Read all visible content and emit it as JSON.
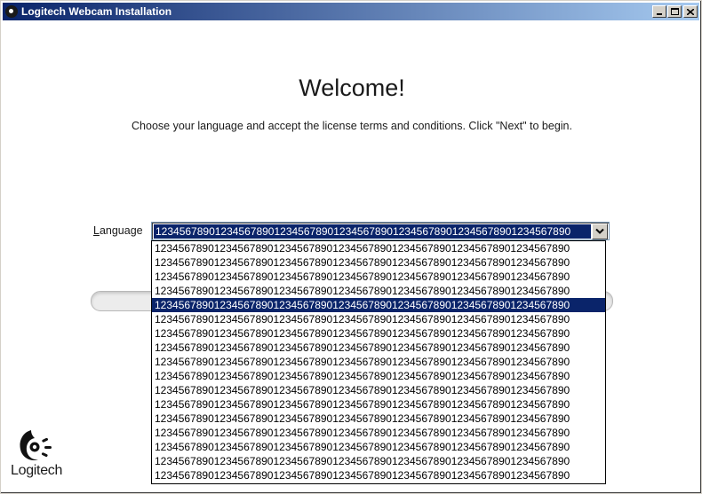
{
  "window": {
    "title": "Logitech Webcam Installation",
    "title_icon": "logitech-icon"
  },
  "main": {
    "heading": "Welcome!",
    "subtitle": "Choose your language and accept the license terms and conditions. Click \"Next\" to begin."
  },
  "language": {
    "label_underlined": "L",
    "label_rest": "anguage",
    "selected_value": "1234567890123456789012345678901234567890123456789012345678901234567890",
    "options": [
      "1234567890123456789012345678901234567890123456789012345678901234567890",
      "1234567890123456789012345678901234567890123456789012345678901234567890",
      "1234567890123456789012345678901234567890123456789012345678901234567890",
      "1234567890123456789012345678901234567890123456789012345678901234567890",
      "1234567890123456789012345678901234567890123456789012345678901234567890",
      "1234567890123456789012345678901234567890123456789012345678901234567890",
      "1234567890123456789012345678901234567890123456789012345678901234567890",
      "1234567890123456789012345678901234567890123456789012345678901234567890",
      "1234567890123456789012345678901234567890123456789012345678901234567890",
      "1234567890123456789012345678901234567890123456789012345678901234567890",
      "1234567890123456789012345678901234567890123456789012345678901234567890",
      "1234567890123456789012345678901234567890123456789012345678901234567890",
      "1234567890123456789012345678901234567890123456789012345678901234567890",
      "1234567890123456789012345678901234567890123456789012345678901234567890",
      "1234567890123456789012345678901234567890123456789012345678901234567890",
      "1234567890123456789012345678901234567890123456789012345678901234567890",
      "1234567890123456789012345678901234567890123456789012345678901234567890"
    ],
    "highlighted_index": 4
  },
  "logo": {
    "text": "Logitech"
  },
  "colors": {
    "selection": "#0a246a",
    "titlebar_start": "#0a246a",
    "titlebar_end": "#a6caf0"
  }
}
